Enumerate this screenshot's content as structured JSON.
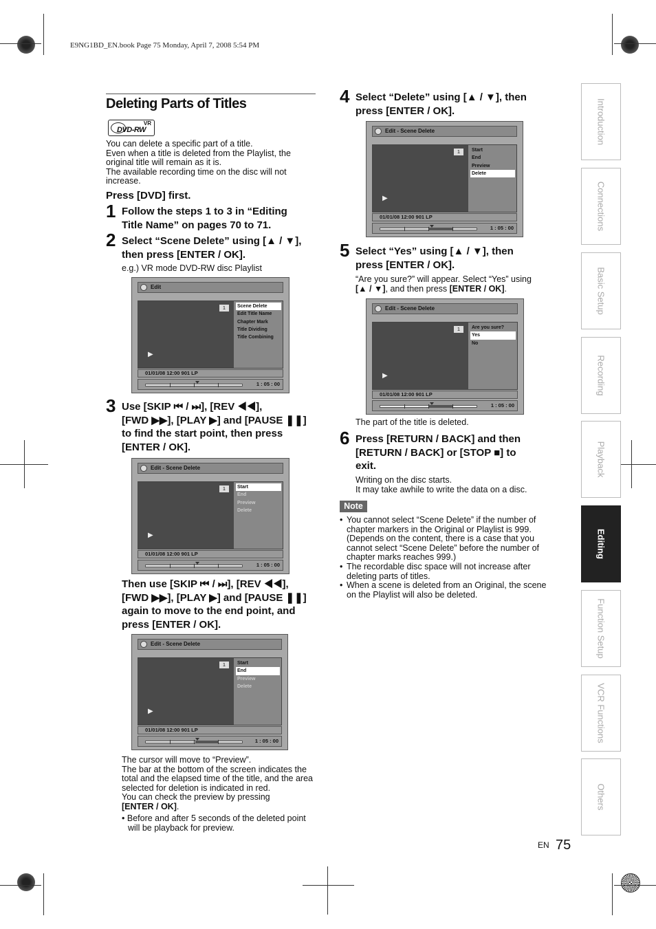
{
  "header": {
    "file_line": "E9NG1BD_EN.book  Page 75  Monday, April 7, 2008  5:54 PM"
  },
  "section": {
    "title": "Deleting Parts of Titles",
    "badge_vr": "VR",
    "badge_disc": "DVD-RW",
    "intro_lines": [
      "You can delete a specific part of a title.",
      "Even when a title is deleted from the Playlist, the",
      "original title will remain as it is.",
      "The available recording time on the disc will not",
      "increase."
    ],
    "press_first": "Press [DVD] first."
  },
  "steps": {
    "s1": {
      "num": "1",
      "lines": [
        "Follow the steps 1 to 3 in “Editing",
        "Title Name” on pages 70 to 71."
      ]
    },
    "s2": {
      "num": "2",
      "lines": [
        "Select “Scene Delete” using [▲ / ▼],",
        "then press [ENTER / OK]."
      ],
      "note": "e.g.) VR mode DVD-RW disc Playlist"
    },
    "s3": {
      "num": "3",
      "lines": [
        "Use [SKIP ⏮ / ⏭], [REV ◀◀],",
        "[FWD ▶▶], [PLAY ▶] and [PAUSE ❚❚]",
        "to find the start point, then press",
        "[ENTER / OK]."
      ]
    },
    "s3b": {
      "lines": [
        "Then use [SKIP ⏮ / ⏭], [REV ◀◀],",
        "[FWD ▶▶], [PLAY ▶] and [PAUSE ❚❚]",
        "again to move to the end point, and",
        "press [ENTER / OK]."
      ]
    },
    "s3_after": [
      "The cursor will move to “Preview”.",
      "The bar at the bottom of the screen indicates the",
      "total and the elapsed time of the title, and the area",
      "selected for deletion is indicated in red.",
      "You can check the preview by pressing"
    ],
    "s3_after_bold": "[ENTER / OK]",
    "s3_after_bold_tail": ".",
    "s3_bullet": [
      "Before and after 5 seconds of the deleted point",
      "will be playback for preview."
    ],
    "s4": {
      "num": "4",
      "lines": [
        "Select “Delete” using [▲ / ▼], then",
        "press [ENTER / OK]."
      ]
    },
    "s5": {
      "num": "5",
      "lines": [
        "Select “Yes” using [▲ / ▼], then",
        "press [ENTER / OK]."
      ],
      "note_line1": "“Are you sure?” will appear. Select “Yes” using",
      "note_line2_bold1": "[▲ / ▼]",
      "note_line2_mid": ", and then press ",
      "note_line2_bold2": "[ENTER / OK]",
      "note_line2_end": ".",
      "after": "The part of the title is deleted."
    },
    "s6": {
      "num": "6",
      "lines": [
        "Press [RETURN / BACK] and then",
        "[RETURN / BACK] or [STOP ■] to",
        "exit."
      ],
      "after": [
        "Writing on the disc starts.",
        "It may take awhile to write the data on a disc."
      ]
    }
  },
  "screens": {
    "edit": {
      "title": "Edit",
      "num": "1",
      "menu": [
        "Scene Delete",
        "Edit Title Name",
        "Chapter Mark",
        "Title Dividing",
        "Title Combining"
      ],
      "info": "01/01/08 12:00      901  LP",
      "time": "1 : 05 : 00"
    },
    "sd_start": {
      "title": "Edit - Scene Delete",
      "num": "1",
      "menu": [
        "Start",
        "End",
        "Preview",
        "Delete"
      ],
      "info": "01/01/08 12:00      901  LP",
      "time": "1 : 05 : 00"
    },
    "sd_end": {
      "title": "Edit - Scene Delete",
      "num": "1",
      "menu": [
        "Start",
        "End",
        "Preview",
        "Delete"
      ],
      "info": "01/01/08 12:00      901  LP",
      "time": "1 : 05 : 00"
    },
    "sd_delete": {
      "title": "Edit - Scene Delete",
      "num": "1",
      "menu": [
        "Start",
        "End",
        "Preview",
        "Delete"
      ],
      "info": "01/01/08 12:00      901  LP",
      "time": "1 : 05 : 00"
    },
    "sd_confirm": {
      "title": "Edit - Scene Delete",
      "num": "1",
      "menu": [
        "Are you sure?",
        "Yes",
        "No"
      ],
      "info": "01/01/08 12:00      901  LP",
      "time": "1 : 05 : 00"
    }
  },
  "note": {
    "label": "Note",
    "items": [
      [
        "You cannot select “Scene Delete” if the number of",
        "chapter markers in the Original or Playlist is 999.",
        "(Depends on the content, there is a case that you",
        "cannot select “Scene Delete” before the number of",
        "chapter marks reaches 999.)"
      ],
      [
        "The recordable disc space will not increase after",
        "deleting parts of titles."
      ],
      [
        "When a scene is deleted from an Original, the scene",
        "on the Playlist will also be deleted."
      ]
    ]
  },
  "side_tabs": [
    "Introduction",
    "Connections",
    "Basic Setup",
    "Recording",
    "Playback",
    "Editing",
    "Function Setup",
    "VCR Functions",
    "Others"
  ],
  "active_tab": "Editing",
  "footer": {
    "lang": "EN",
    "page": "75"
  }
}
